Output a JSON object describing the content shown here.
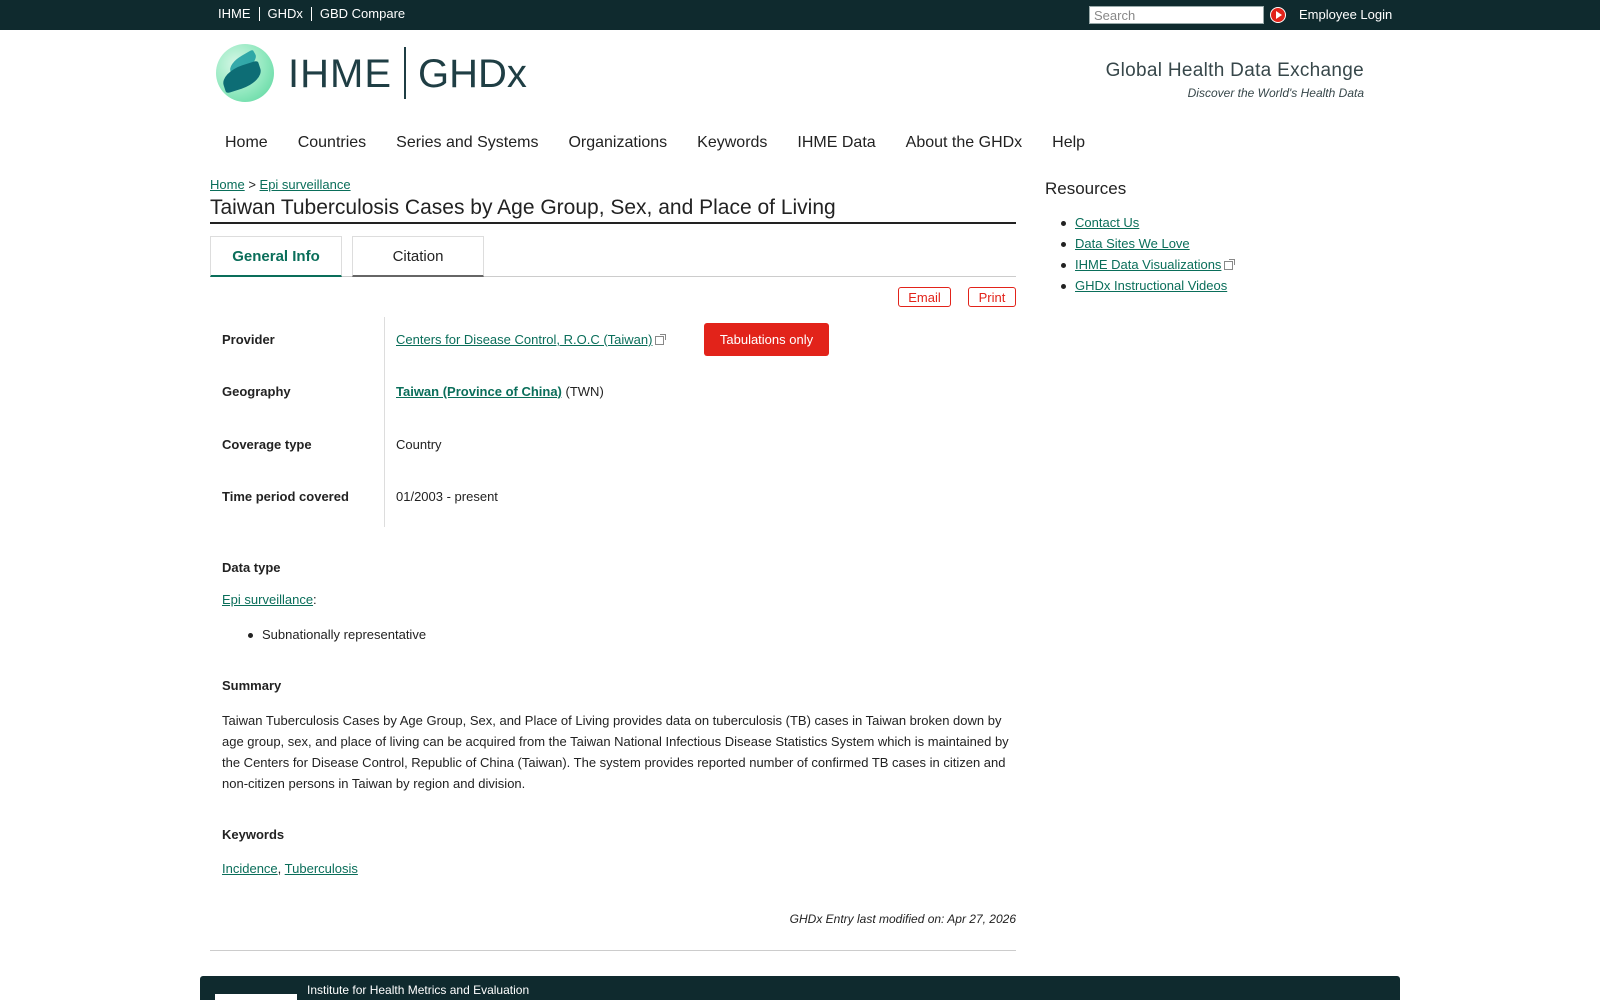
{
  "topbar": {
    "links": [
      "IHME",
      "GHDx",
      "GBD Compare"
    ],
    "search_placeholder": "Search",
    "employee_login": "Employee Login"
  },
  "header": {
    "brand_left": "IHME",
    "brand_right": "GHDx",
    "tagline_title": "Global Health Data Exchange",
    "tagline_sub": "Discover the World's Health Data"
  },
  "nav": [
    "Home",
    "Countries",
    "Series and Systems",
    "Organizations",
    "Keywords",
    "IHME Data",
    "About the GHDx",
    "Help"
  ],
  "breadcrumb": {
    "home": "Home",
    "sep": ">",
    "current": "Epi surveillance"
  },
  "page_title": "Taiwan Tuberculosis Cases by Age Group, Sex, and Place of Living",
  "tabs": [
    "General Info",
    "Citation"
  ],
  "actions": {
    "email": "Email",
    "print": "Print"
  },
  "info": {
    "provider_label": "Provider",
    "provider_value": "Centers for Disease Control, R.O.C (Taiwan)",
    "provider_badge": "Tabulations only",
    "geography_label": "Geography",
    "geography_value": "Taiwan (Province of China)",
    "geography_code": "(TWN)",
    "coverage_label": "Coverage type",
    "coverage_value": "Country",
    "time_label": "Time period covered",
    "time_value": "01/2003 - present"
  },
  "data_type": {
    "heading": "Data type",
    "link": "Epi surveillance",
    "colon": ":",
    "bullet": "Subnationally representative"
  },
  "summary": {
    "heading": "Summary",
    "text": "Taiwan Tuberculosis Cases by Age Group, Sex, and Place of Living provides data on tuberculosis (TB) cases in Taiwan broken down by age group, sex, and place of living can be acquired from the Taiwan National Infectious Disease Statistics System which is maintained by the Centers for Disease Control, Republic of China (Taiwan). The system provides reported number of confirmed TB cases in citizen and non-citizen persons in Taiwan by region and division."
  },
  "keywords": {
    "heading": "Keywords",
    "items": [
      "Incidence",
      "Tuberculosis"
    ],
    "sep": ","
  },
  "modified": "GHDx Entry last modified on: Apr 27, 2026",
  "sidebar": {
    "heading": "Resources",
    "items": [
      "Contact Us",
      "Data Sites We Love",
      "IHME Data Visualizations",
      "GHDx Instructional Videos"
    ]
  },
  "footer": {
    "text": "Institute for Health Metrics and Evaluation"
  },
  "colors": {
    "topbar": "#0f2a2e",
    "link": "#0a6e5a",
    "accent_red": "#e2231a"
  }
}
